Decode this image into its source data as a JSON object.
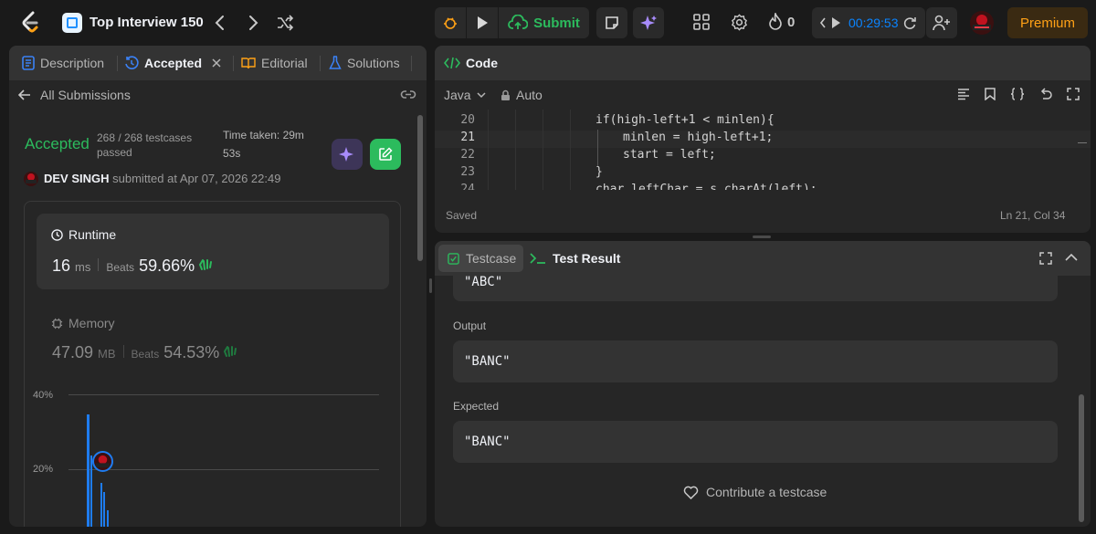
{
  "header": {
    "problem_list_title": "Top Interview 150",
    "submit_label": "Submit",
    "streak_count": "0",
    "timer": "00:29:53",
    "premium_label": "Premium"
  },
  "left_panel": {
    "tabs": [
      {
        "label": "Description"
      },
      {
        "label": "Accepted"
      },
      {
        "label": "Editorial"
      },
      {
        "label": "Solutions"
      }
    ],
    "back_label": "All Submissions",
    "status": "Accepted",
    "testcases": "268 / 268 testcases passed",
    "time_taken": "Time taken: 29m 53s",
    "user_name": "DEV SINGH",
    "submitted_text": "submitted at Apr 07, 2026 22:49",
    "runtime": {
      "title": "Runtime",
      "value": "16",
      "unit": "ms",
      "beats_label": "Beats",
      "beats_value": "59.66%"
    },
    "memory": {
      "title": "Memory",
      "value": "47.09",
      "unit": "MB",
      "beats_label": "Beats",
      "beats_value": "54.53%"
    },
    "distribution": {
      "y_ticks": [
        "40%",
        "20%"
      ]
    }
  },
  "code_panel": {
    "title": "Code",
    "language": "Java",
    "mode": "Auto",
    "lines": [
      {
        "num": "20",
        "text": "if(high-left+1 < minlen){",
        "indent": 0
      },
      {
        "num": "21",
        "text": "minlen = high-left+1;",
        "indent": 1
      },
      {
        "num": "22",
        "text": "start = left;",
        "indent": 1
      },
      {
        "num": "23",
        "text": "}",
        "indent": 0
      },
      {
        "num": "24",
        "text": "char leftChar = s.charAt(left);",
        "indent": 0
      }
    ],
    "saved_label": "Saved",
    "cursor_pos": "Ln 21, Col 34"
  },
  "test_panel": {
    "tab_testcase": "Testcase",
    "tab_result": "Test Result",
    "input_value": "\"ABC\"",
    "output_label": "Output",
    "output_value": "\"BANC\"",
    "expected_label": "Expected",
    "expected_value": "\"BANC\"",
    "contribute_label": "Contribute a testcase"
  },
  "colors": {
    "accent_green": "#2cbb5d",
    "timer_blue": "#0a84ff",
    "premium_orange": "#ffa116",
    "bar_blue": "#1e7cf0"
  }
}
